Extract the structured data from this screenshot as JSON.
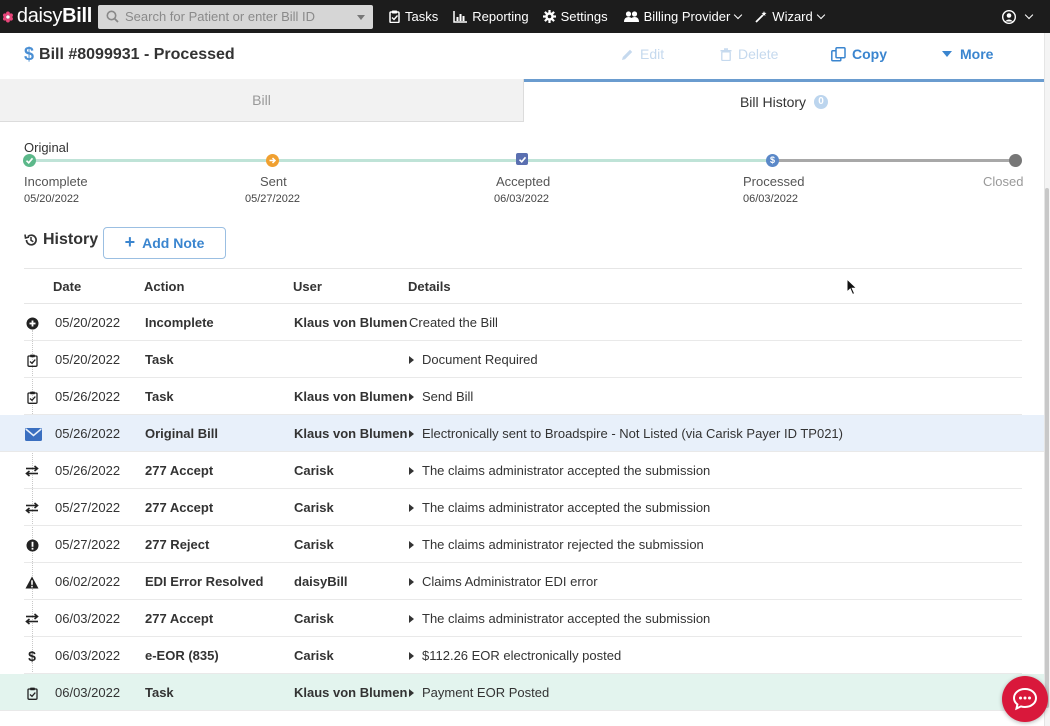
{
  "nav": {
    "logo_light": "daisy",
    "logo_bold": "Bill",
    "search_placeholder": "Search for Patient or enter Bill ID",
    "items": [
      {
        "label": "Tasks",
        "icon": "clipboard-icon"
      },
      {
        "label": "Reporting",
        "icon": "bar-chart-icon"
      },
      {
        "label": "Settings",
        "icon": "gear-icon"
      },
      {
        "label": "Billing Provider",
        "icon": "users-icon"
      },
      {
        "label": "Wizard",
        "icon": "magic-wand-icon"
      }
    ],
    "user_icon": "user-circle-icon"
  },
  "title": {
    "currency_symbol": "$",
    "text": "Bill #8099931 - Processed"
  },
  "actions": {
    "edit": "Edit",
    "delete": "Delete",
    "copy": "Copy",
    "more": "More"
  },
  "tabs": {
    "bill": "Bill",
    "history": "Bill History",
    "history_badge": "0"
  },
  "timeline": {
    "original_label": "Original",
    "steps": [
      {
        "label": "Incomplete",
        "date": "05/20/2022",
        "color": "#5cb88a"
      },
      {
        "label": "Sent",
        "date": "05/27/2022",
        "color": "#f0a030"
      },
      {
        "label": "Accepted",
        "date": "06/03/2022",
        "color": "#5a6fb0"
      },
      {
        "label": "Processed",
        "date": "06/03/2022",
        "color": "#5a88c8"
      },
      {
        "label": "Closed",
        "date": "",
        "color": "#777777"
      }
    ]
  },
  "history": {
    "title": "History",
    "add_note": "Add Note",
    "columns": {
      "date": "Date",
      "action": "Action",
      "user": "User",
      "details": "Details"
    },
    "rows": [
      {
        "icon": "plus-circle-icon",
        "date": "05/20/2022",
        "action": "Incomplete",
        "user": "Klaus von Blumen",
        "details": "Created the Bill",
        "expandable": false
      },
      {
        "icon": "clipboard-check-icon",
        "date": "05/20/2022",
        "action": "Task",
        "user": "",
        "details": "Document Required",
        "expandable": true
      },
      {
        "icon": "clipboard-check-icon",
        "date": "05/26/2022",
        "action": "Task",
        "user": "Klaus von Blumen",
        "details": "Send Bill",
        "expandable": true
      },
      {
        "icon": "envelope-icon",
        "date": "05/26/2022",
        "action": "Original Bill",
        "user": "Klaus von Blumen",
        "details": "Electronically sent to Broadspire - Not Listed (via Carisk Payer ID TP021)",
        "expandable": true
      },
      {
        "icon": "exchange-icon",
        "date": "05/26/2022",
        "action": "277 Accept",
        "user": "Carisk",
        "details": "The claims administrator accepted the submission",
        "expandable": true
      },
      {
        "icon": "exchange-icon",
        "date": "05/27/2022",
        "action": "277 Accept",
        "user": "Carisk",
        "details": "The claims administrator accepted the submission",
        "expandable": true
      },
      {
        "icon": "exclamation-circle-icon",
        "date": "05/27/2022",
        "action": "277 Reject",
        "user": "Carisk",
        "details": "The claims administrator rejected the submission",
        "expandable": true
      },
      {
        "icon": "warning-triangle-icon",
        "date": "06/02/2022",
        "action": "EDI Error Resolved",
        "user": "daisyBill",
        "details": "Claims Administrator EDI error",
        "expandable": true
      },
      {
        "icon": "exchange-icon",
        "date": "06/03/2022",
        "action": "277 Accept",
        "user": "Carisk",
        "details": "The claims administrator accepted the submission",
        "expandable": true
      },
      {
        "icon": "dollar-icon",
        "date": "06/03/2022",
        "action": "e-EOR (835)",
        "user": "Carisk",
        "details": "$112.26 EOR electronically posted",
        "expandable": true
      },
      {
        "icon": "clipboard-check-icon",
        "date": "06/03/2022",
        "action": "Task",
        "user": "Klaus von Blumen",
        "details": "Payment EOR Posted",
        "expandable": true
      }
    ]
  },
  "chat_icon": "chat-bubble-icon"
}
